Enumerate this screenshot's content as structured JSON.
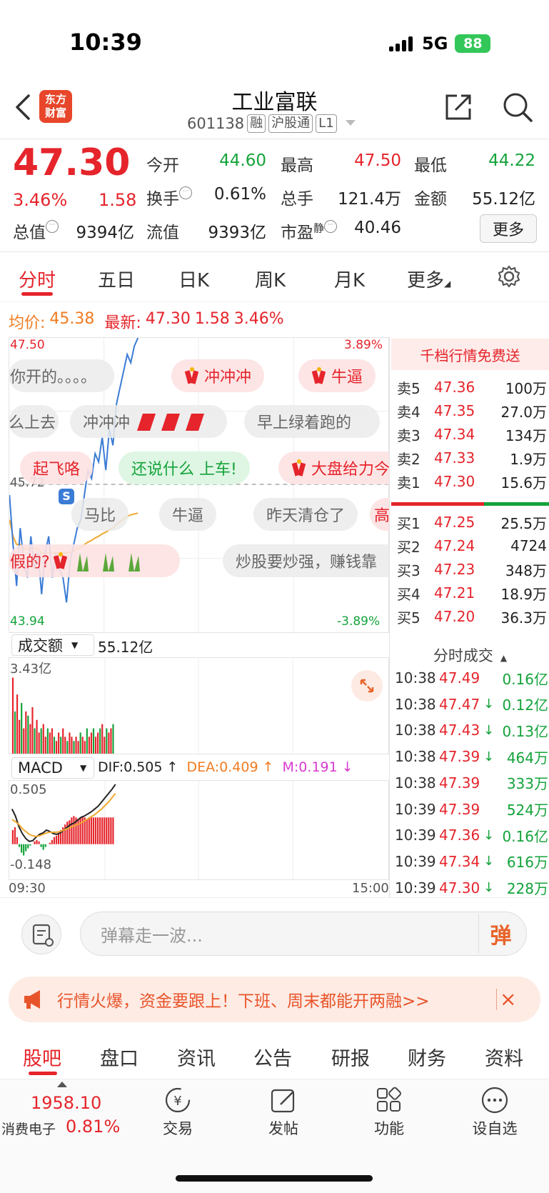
{
  "status": {
    "time": "10:39",
    "network": "5G",
    "battery": "88"
  },
  "header": {
    "logo": [
      "东方",
      "财富"
    ],
    "stock_name": "工业富联",
    "code": "601138",
    "tags": [
      "融",
      "沪股通",
      "L1"
    ]
  },
  "quote": {
    "price": "47.30",
    "pct": "3.46%",
    "change": "1.58",
    "open_label": "今开",
    "open": "44.60",
    "high_label": "最高",
    "high": "47.50",
    "low_label": "最低",
    "low": "44.22",
    "turnover_label": "换手",
    "turnover": "0.61%",
    "volume_label": "总手",
    "volume": "121.4万",
    "amount_label": "金额",
    "amount": "55.12亿",
    "mcap_label": "总值",
    "mcap": "9394亿",
    "float_label": "流值",
    "float": "9393亿",
    "pe_label": "市盈",
    "pe_sup": "静",
    "pe": "40.46",
    "more_label": "更多"
  },
  "period_tabs": [
    "分时",
    "五日",
    "日K",
    "周K",
    "月K",
    "更多"
  ],
  "price_line": {
    "avg_label": "均价:",
    "avg": "45.38",
    "latest_label": "最新:",
    "latest": "47.30",
    "chg": "1.58",
    "pct": "3.46%"
  },
  "axis": {
    "top_price": "47.50",
    "mid_price": "45.72",
    "bottom_price": "43.94",
    "top_pct": "3.89%",
    "bottom_pct": "-3.89%"
  },
  "danmaku": [
    "你开的。。。。",
    "冲冲冲",
    "牛逼",
    "么上去",
    "冲冲冲",
    "早上绿着跑的",
    "起飞咯",
    "还说什么 上车!",
    "大盘给力今",
    "马比",
    "牛逼",
    "昨天清仓了",
    "高",
    "假的?",
    "炒股要炒强，赚钱靠"
  ],
  "order_book": {
    "promo": "千档行情免费送",
    "asks": [
      {
        "label": "卖5",
        "price": "47.36",
        "vol": "100万"
      },
      {
        "label": "卖4",
        "price": "47.35",
        "vol": "27.0万"
      },
      {
        "label": "卖3",
        "price": "47.34",
        "vol": "134万"
      },
      {
        "label": "卖2",
        "price": "47.33",
        "vol": "1.9万"
      },
      {
        "label": "卖1",
        "price": "47.30",
        "vol": "15.6万"
      }
    ],
    "bids": [
      {
        "label": "买1",
        "price": "47.25",
        "vol": "25.5万"
      },
      {
        "label": "买2",
        "price": "47.24",
        "vol": "4724"
      },
      {
        "label": "买3",
        "price": "47.23",
        "vol": "348万"
      },
      {
        "label": "买4",
        "price": "47.21",
        "vol": "18.9万"
      },
      {
        "label": "买5",
        "price": "47.20",
        "vol": "36.3万"
      }
    ]
  },
  "trades": {
    "title": "分时成交",
    "rows": [
      {
        "time": "10:38",
        "price": "47.49",
        "arrow": "",
        "vol": "0.16亿",
        "color": "#14a33b"
      },
      {
        "time": "10:38",
        "price": "47.47",
        "arrow": "↓",
        "vol": "0.12亿",
        "color": "#14a33b"
      },
      {
        "time": "10:38",
        "price": "47.43",
        "arrow": "↓",
        "vol": "0.13亿",
        "color": "#14a33b"
      },
      {
        "time": "10:38",
        "price": "47.39",
        "arrow": "↓",
        "vol": "464万",
        "color": "#14a33b"
      },
      {
        "time": "10:38",
        "price": "47.39",
        "arrow": "",
        "vol": "333万",
        "color": "#14a33b"
      },
      {
        "time": "10:39",
        "price": "47.39",
        "arrow": "",
        "vol": "524万",
        "color": "#14a33b"
      },
      {
        "time": "10:39",
        "price": "47.36",
        "arrow": "↓",
        "vol": "0.16亿",
        "color": "#14a33b"
      },
      {
        "time": "10:39",
        "price": "47.34",
        "arrow": "↓",
        "vol": "616万",
        "color": "#14a33b"
      },
      {
        "time": "10:39",
        "price": "47.30",
        "arrow": "↓",
        "vol": "228万",
        "color": "#14a33b"
      }
    ]
  },
  "volume": {
    "selector": "成交额",
    "total": "55.12亿",
    "max": "3.43亿"
  },
  "macd": {
    "selector": "MACD",
    "dif": "DIF:0.505 ↑",
    "dea": "DEA:0.409 ↑",
    "m": "M:0.191 ↓",
    "top": "0.505",
    "bottom": "-0.148"
  },
  "time_axis": {
    "start": "09:30",
    "end": "15:00"
  },
  "comment": {
    "placeholder": "弹幕走一波...",
    "send": "弹"
  },
  "promo": {
    "text": "行情火爆，资金要跟上！下班、周末都能开两融>>",
    "close": "×"
  },
  "bottom_tabs": [
    "股吧",
    "盘口",
    "资讯",
    "公告",
    "研报",
    "财务",
    "资料"
  ],
  "toolbar": {
    "index_value": "1958.10",
    "index_name": "消费电子",
    "index_pct": "0.81%",
    "items": [
      "交易",
      "发帖",
      "功能",
      "设自选"
    ]
  },
  "colors": {
    "up": "#e5242b",
    "down": "#14a33b",
    "accent": "#f07c22",
    "price_line": "#3a7bd5",
    "avg_line": "#f0a830"
  }
}
